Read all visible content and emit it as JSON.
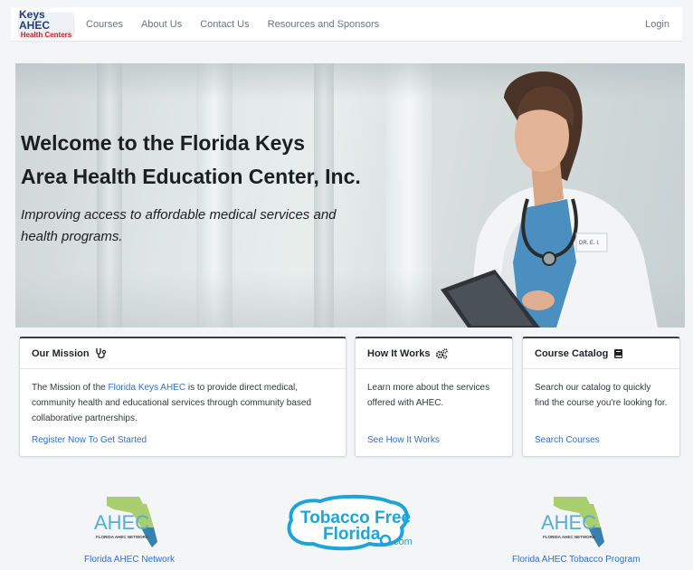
{
  "nav": {
    "logo_line1": "Keys AHEC",
    "logo_line2": "Health Centers",
    "links": [
      "Courses",
      "About Us",
      "Contact Us",
      "Resources and Sponsors"
    ],
    "login": "Login"
  },
  "hero": {
    "title_line1": "Welcome to the Florida Keys",
    "title_line2": "Area Health Education Center, Inc.",
    "subtitle_line1": "Improving access to affordable medical services and",
    "subtitle_line2": "health programs.",
    "badge_text": "DR. E. I."
  },
  "cards": {
    "mission": {
      "title": "Our Mission",
      "text_before": "The Mission of the ",
      "text_link": "Florida Keys AHEC",
      "text_after": " is to provide direct medical, community health and educational services through community based collaborative partnerships.",
      "link": "Register Now To Get Started"
    },
    "how": {
      "title": "How It Works",
      "text": "Learn more about the services offered with AHEC.",
      "link": "See How It Works"
    },
    "catalog": {
      "title": "Course Catalog",
      "text": "Search our catalog to quickly find the course you're looking for.",
      "link": "Search Courses"
    }
  },
  "sponsors": {
    "left": {
      "logo_text": "AHEC",
      "logo_sub": "FLORIDA AHEC NETWORK",
      "caption": "Florida AHEC Network"
    },
    "middle": {
      "line1": "Tobacco Free",
      "line2": "Florida",
      "suffix": ".com"
    },
    "right": {
      "logo_text": "AHEC",
      "logo_sub": "FLORIDA AHEC NETWORK",
      "caption": "Florida AHEC Tobacco Program"
    }
  },
  "colors": {
    "link": "#2e6fc7",
    "logo_blue": "#1d3e7a",
    "logo_red": "#c0262e",
    "tobacco_blue": "#1fa3d8",
    "ahec_green": "#8fc03f"
  }
}
